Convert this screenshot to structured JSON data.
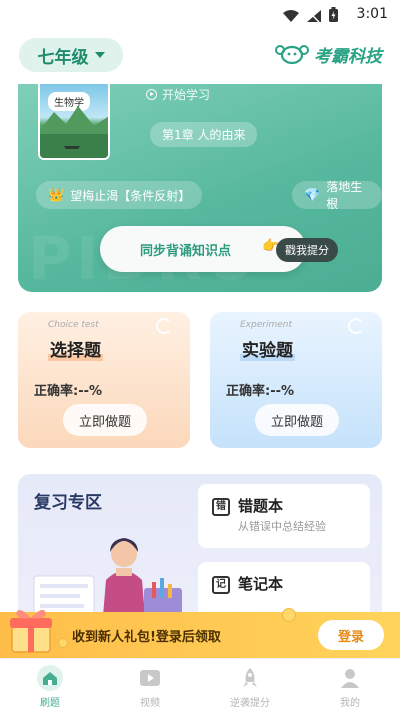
{
  "status_bar": {
    "time": "3:01",
    "icons": [
      "wifi-icon",
      "signal-icon",
      "battery-icon"
    ]
  },
  "header": {
    "grade": "七年级",
    "brand_name": "考霸科技"
  },
  "hero": {
    "book_title": "生物学",
    "start_label": "开始学习",
    "chapter": "第1章 人的由来",
    "tags": [
      {
        "icon": "crown-icon",
        "label": "望梅止渴【条件反射】"
      },
      {
        "icon": "gem-icon",
        "label": "落地生根"
      }
    ],
    "recite_button": "同步背诵知识点",
    "recite_badge": "戳我提分"
  },
  "practice_cards": [
    {
      "en_label": "Choice test",
      "title": "选择题",
      "accuracy": "正确率:--%",
      "button": "立即做题"
    },
    {
      "en_label": "Experiment",
      "title": "实验题",
      "accuracy": "正确率:--%",
      "button": "立即做题"
    }
  ],
  "review": {
    "title": "复习专区",
    "items": [
      {
        "title": "错题本",
        "subtitle": "从错误中总结经验"
      },
      {
        "title": "笔记本",
        "subtitle": ""
      }
    ]
  },
  "promo": {
    "text": "收到新人礼包!登录后领取",
    "button": "登录"
  },
  "tabbar": {
    "tabs": [
      {
        "label": "刷题",
        "icon": "home-icon",
        "active": true
      },
      {
        "label": "视频",
        "icon": "video-icon",
        "active": false
      },
      {
        "label": "逆袭提分",
        "icon": "rocket-icon",
        "active": false
      },
      {
        "label": "我的",
        "icon": "profile-icon",
        "active": false
      }
    ]
  },
  "colors": {
    "accent": "#45ae92",
    "orange_card": "#fbd8bb",
    "blue_card": "#c5e2fb",
    "promo": "#ffc64f"
  }
}
